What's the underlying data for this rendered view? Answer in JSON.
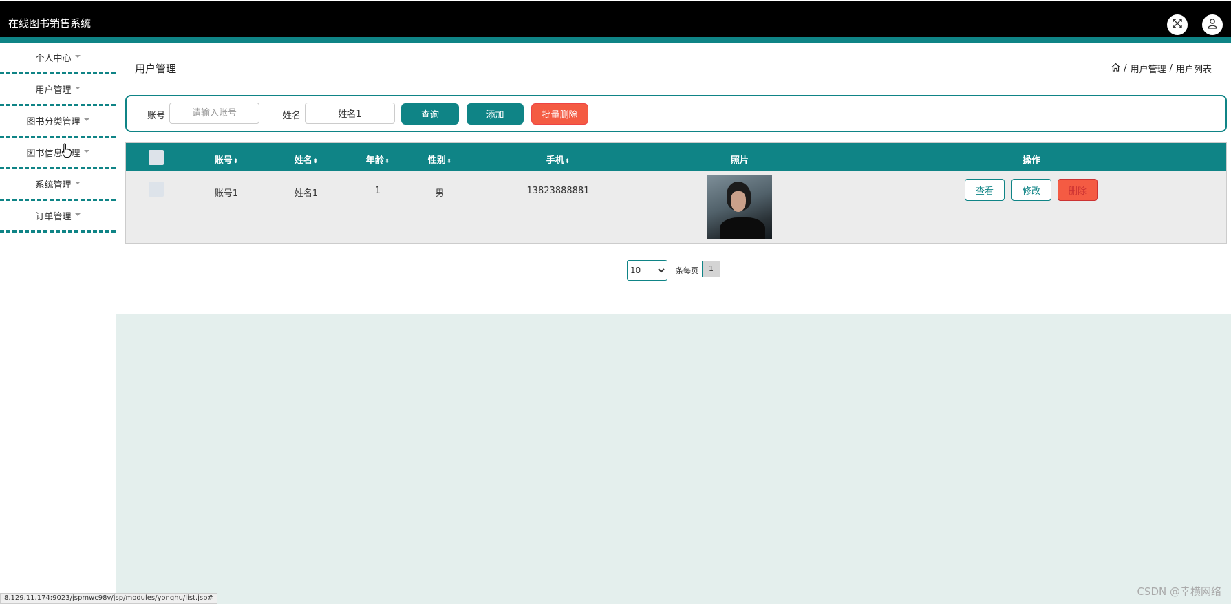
{
  "header": {
    "app_title": "在线图书销售系统",
    "icons": [
      "fullscreen-icon",
      "user-icon"
    ]
  },
  "sidebar": {
    "items": [
      {
        "label": "个人中心"
      },
      {
        "label": "用户管理"
      },
      {
        "label": "图书分类管理"
      },
      {
        "label": "图书信息管理"
      },
      {
        "label": "系统管理"
      },
      {
        "label": "订单管理"
      }
    ]
  },
  "page": {
    "title": "用户管理",
    "breadcrumb": [
      "用户管理",
      "用户列表"
    ],
    "breadcrumb_sep": "/"
  },
  "search": {
    "account_label": "账号",
    "account_placeholder": "请输入账号",
    "account_value": "",
    "name_label": "姓名",
    "name_value": "姓名1",
    "query_button": "查询",
    "add_button": "添加",
    "batch_delete_button": "批量删除"
  },
  "table": {
    "columns": [
      "账号",
      "姓名",
      "年龄",
      "性别",
      "手机",
      "照片",
      "操作"
    ],
    "sortable": [
      true,
      true,
      true,
      true,
      true,
      false,
      false
    ],
    "rows": [
      {
        "account": "账号1",
        "name": "姓名1",
        "age": "1",
        "gender": "男",
        "phone": "13823888881"
      }
    ],
    "actions": {
      "view": "查看",
      "edit": "修改",
      "delete": "删除"
    }
  },
  "pagination": {
    "page_size": "10",
    "page_size_options": [
      "10"
    ],
    "per_page_label": "条每页",
    "current_page": "1"
  },
  "status_bar": {
    "url": "8.129.11.174:9023/jspmwc98v/jsp/modules/yonghu/list.jsp#"
  },
  "watermark": "CSDN @幸横网络",
  "colors": {
    "primary": "#0f8486",
    "danger": "#f45b43",
    "header_bg": "#000000"
  }
}
